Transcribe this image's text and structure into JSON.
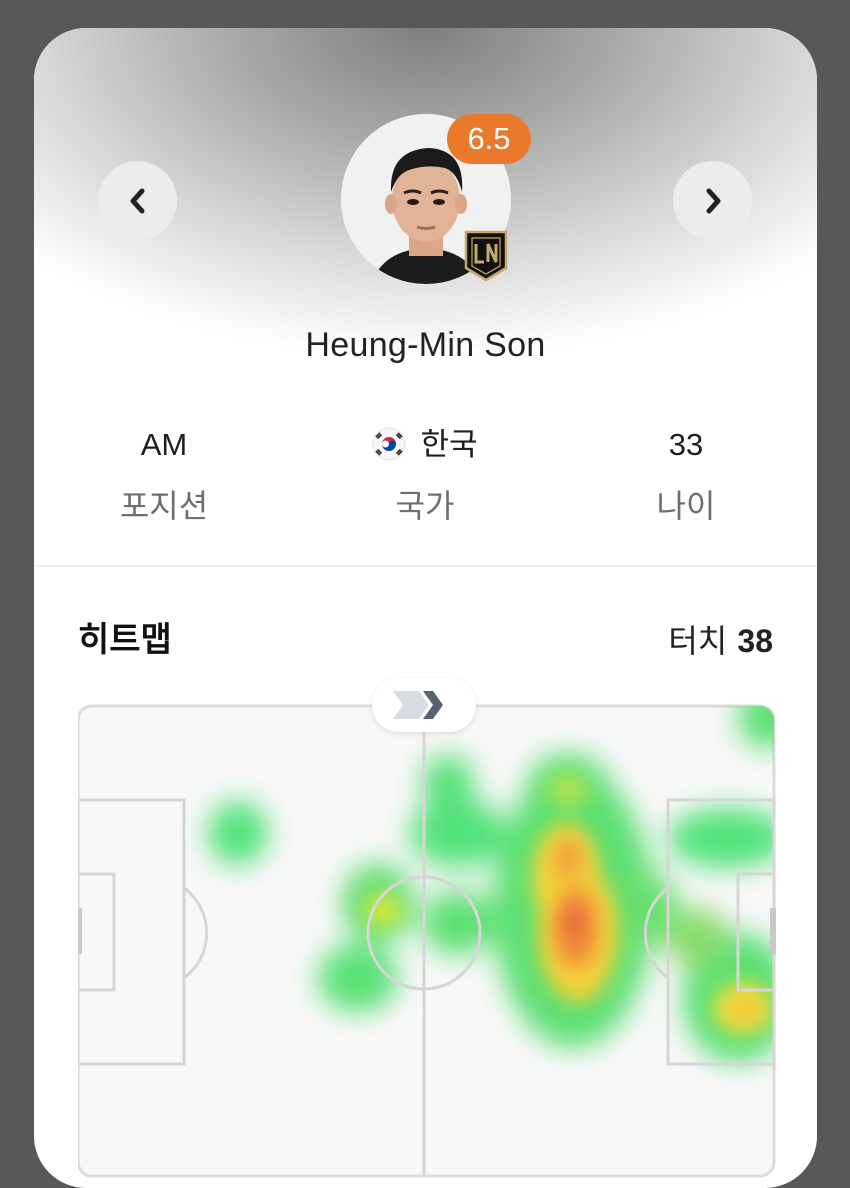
{
  "player": {
    "name": "Heung-Min Son",
    "rating": "6.5",
    "club_badge_text": "LAFC"
  },
  "nav": {
    "prev_icon": "chevron-left-icon",
    "next_icon": "chevron-right-icon"
  },
  "info": [
    {
      "value": "AM",
      "label": "포지션"
    },
    {
      "value": "한국",
      "label": "국가",
      "flag": "south-korea-flag-icon"
    },
    {
      "value": "33",
      "label": "나이"
    }
  ],
  "heatmap": {
    "title": "히트맵",
    "touches_label": "터치",
    "touches_value": "38",
    "direction_icon": "attack-direction-chevrons-icon"
  },
  "colors": {
    "rating_badge": "#ea7a2b",
    "background": "#585858",
    "card": "#ffffff"
  }
}
